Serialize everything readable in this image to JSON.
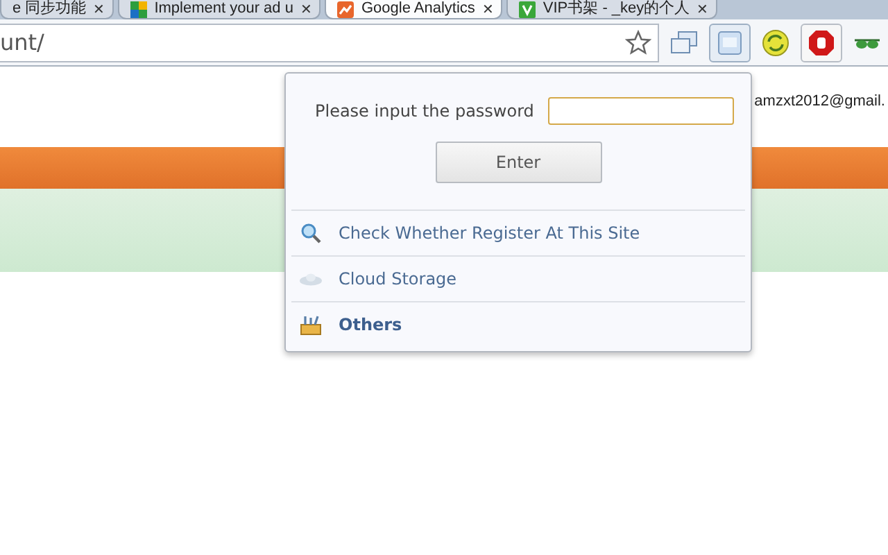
{
  "tabs": [
    {
      "title": "e 同步功能",
      "close": "✕",
      "selected": false
    },
    {
      "title": "Implement your ad u",
      "close": "✕",
      "selected": false
    },
    {
      "title": "Google Analytics",
      "close": "✕",
      "selected": true
    },
    {
      "title": "VIP书架 - _key的个人",
      "close": "✕",
      "selected": false
    }
  ],
  "address_bar": {
    "value": "unt/"
  },
  "page": {
    "account_email": "amzxt2012@gmail."
  },
  "popup": {
    "password_label": "Please input the password",
    "button": "Enter",
    "items": [
      {
        "kind": "search",
        "label": "Check Whether Register At This Site",
        "emphasized": false
      },
      {
        "kind": "cloud",
        "label": "Cloud Storage",
        "emphasized": false
      },
      {
        "kind": "others",
        "label": "Others",
        "emphasized": true
      }
    ]
  }
}
